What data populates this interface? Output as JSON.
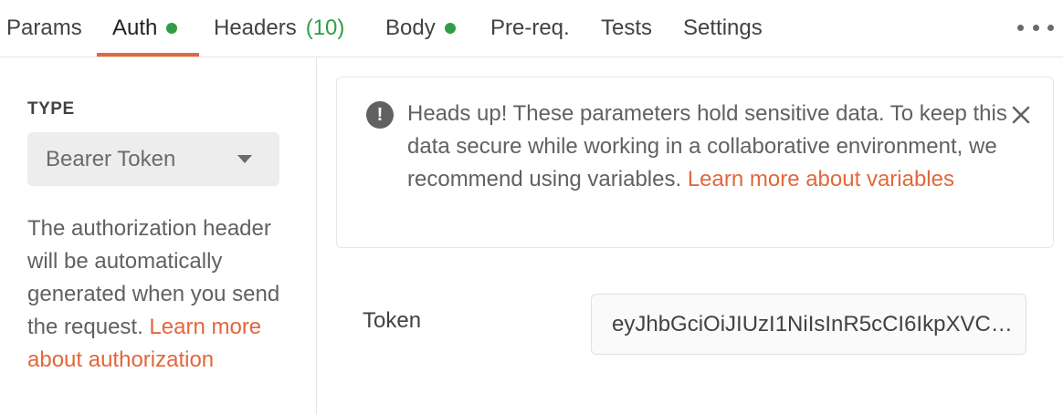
{
  "tabs": [
    {
      "label": "Params"
    },
    {
      "label": "Auth",
      "active": true,
      "dot": true
    },
    {
      "label": "Headers",
      "count": "(10)"
    },
    {
      "label": "Body",
      "dot": true
    },
    {
      "label": "Pre-req."
    },
    {
      "label": "Tests"
    },
    {
      "label": "Settings"
    }
  ],
  "auth": {
    "type_label": "TYPE",
    "type_value": "Bearer Token",
    "description": "The authorization header will be automatically generated when you send the request.",
    "description_link": "Learn more about authorization"
  },
  "alert": {
    "text": "Heads up! These parameters hold sensitive data. To keep this data secure while working in a collaborative environment, we recommend using variables.",
    "link": "Learn more about variables"
  },
  "token": {
    "label": "Token",
    "value": "eyJhbGciOiJIUzI1NiIsInR5cCI6IkpXVCJ9..."
  },
  "colors": {
    "accent": "#e2673b",
    "success": "#2f9e44",
    "muted_text": "#616161"
  }
}
